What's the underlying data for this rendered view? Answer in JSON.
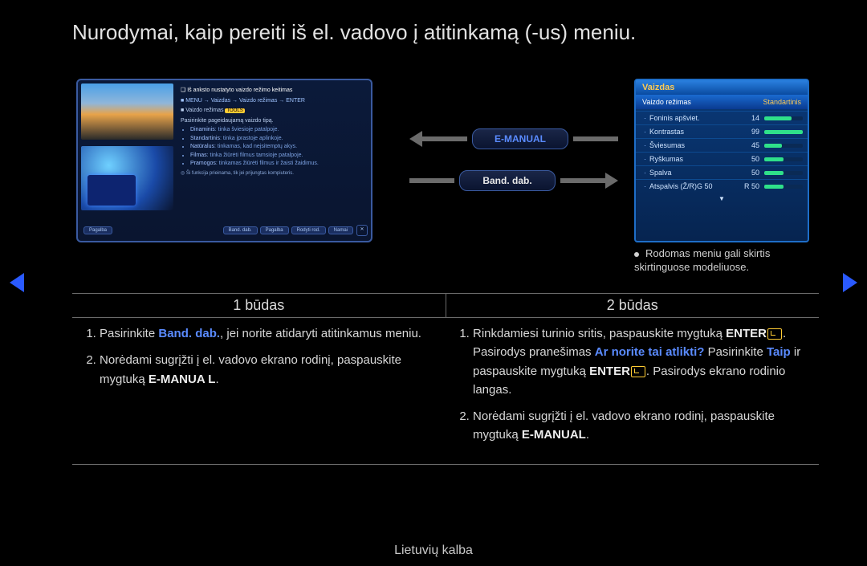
{
  "title": "Nurodymai, kaip pereiti iš el. vadovo į atitinkamą (-us) meniu.",
  "mini": {
    "header": "Iš anksto nustatyto vaizdo režimo keitimas",
    "path_prefix": "MENU",
    "path_seg1": "Vaizdas",
    "path_seg2": "Vaizdo režimas",
    "path_seg3": "ENTER",
    "mode_label": "Vaizdo režimas",
    "mode_tools": "TOOLS",
    "mode_desc": "Pasirinkite pageidaujamą vaizdo tipą.",
    "items": [
      {
        "k": "Dinaminis",
        "d": ": tinka šviesioje patalpoje."
      },
      {
        "k": "Standartinis",
        "d": ": tinka įprastoje aplinkoje."
      },
      {
        "k": "Natūralus",
        "d": ": tinkamas, kad neįsitemptų akys."
      },
      {
        "k": "Filmas",
        "d": ": tinka žiūrėti filmus tamsioje patalpoje."
      },
      {
        "k": "Pramogos",
        "d": ": tinkamas žiūrėti filmus ir žaisti žaidimus."
      }
    ],
    "note": "Ši funkcija prieinama, tik jei prijungtas kompiuteris.",
    "foot": {
      "l": "Pagalba",
      "r1": "Band. dab.",
      "r2": "Pagalba",
      "r3": "Rodyti rod.",
      "r4": "Namai"
    }
  },
  "center": {
    "emanual": "E-MANUAL",
    "band": "Band. dab."
  },
  "osd": {
    "title": "Vaizdas",
    "sel_label": "Vaizdo režimas",
    "sel_value": "Standartinis",
    "rows": [
      {
        "label": "Foninis apšviet.",
        "value": "14",
        "pct": 70
      },
      {
        "label": "Kontrastas",
        "value": "99",
        "pct": 99
      },
      {
        "label": "Šviesumas",
        "value": "45",
        "pct": 45
      },
      {
        "label": "Ryškumas",
        "value": "50",
        "pct": 50
      },
      {
        "label": "Spalva",
        "value": "50",
        "pct": 50
      },
      {
        "label": "Atspalvis (Ž/R)G 50",
        "value": "R 50",
        "pct": 50
      }
    ]
  },
  "osd_note": "Rodomas meniu gali skirtis skirtinguose modeliuose.",
  "table": {
    "h1": "1 būdas",
    "h2": "2 būdas",
    "c1": {
      "i1a": "Pasirinkite ",
      "i1b": "Band. dab.",
      "i1c": ", jei norite atidaryti atitinkamus meniu.",
      "i2a": "Norėdami sugrįžti į el. vadovo ekrano rodinį, paspauskite mygtuką ",
      "i2b": "E-MANUA L",
      "i2c": "."
    },
    "c2": {
      "i1a": "Rinkdamiesi turinio sritis, paspauskite mygtuką ",
      "i1b": "ENTER",
      "i1c": ". Pasirodys pranešimas ",
      "i1d": "Ar norite tai atlikti?",
      "i1e": " Pasirinkite ",
      "i1f": "Taip",
      "i1g": " ir paspauskite mygtuką ",
      "i1h": "ENTER",
      "i1i": ". Pasirodys ekrano rodinio langas.",
      "i2a": "Norėdami sugrįžti į el. vadovo ekrano rodinį, paspauskite mygtuką ",
      "i2b": "E-MANUAL",
      "i2c": "."
    }
  },
  "footer": "Lietuvių kalba"
}
